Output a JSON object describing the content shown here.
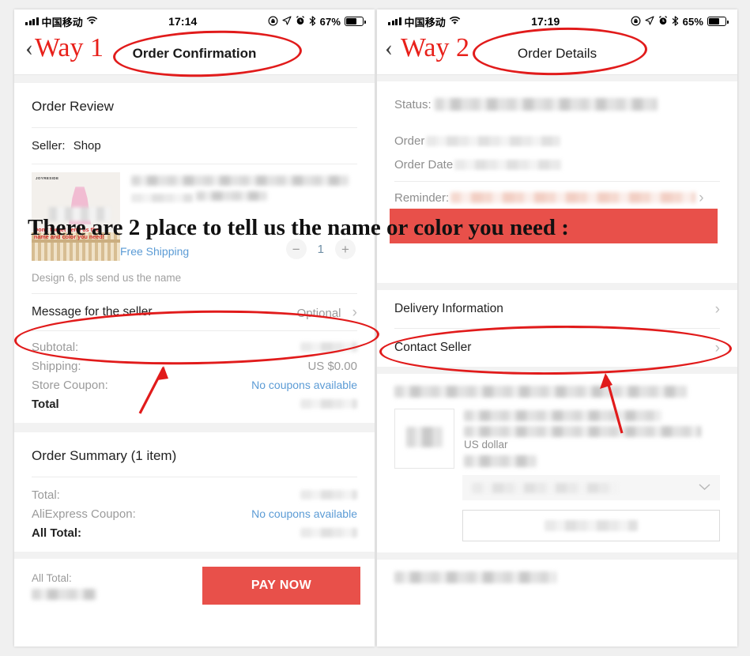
{
  "annotations": {
    "way1_label": "Way 1",
    "way2_label": "Way 2",
    "back_chevron": "‹",
    "overlay_line": "There are 2 place to tell us the name or color you need :",
    "accent_red": "#e11b1b",
    "band_red": "#e8504a"
  },
  "left_phone": {
    "statusbar": {
      "carrier": "中国移动",
      "wifi_icon": "wifi-icon",
      "time": "17:14",
      "rotation_lock_icon": "rotation-lock-icon",
      "location_icon": "location-arrow-icon",
      "alarm_icon": "alarm-clock-icon",
      "bluetooth_icon": "bluetooth-icon",
      "battery_percent": "67%",
      "battery_level": 67
    },
    "navbar": {
      "title": "Order Confirmation"
    },
    "order_review": {
      "heading": "Order Review",
      "seller_label": "Seller:",
      "seller_name": "Shop",
      "product_image": {
        "brand": "JOYRESIDE",
        "caption_line1": "Don't forget send us the",
        "caption_line2": "name and color you need!"
      },
      "shipping_tag": "Free Shipping",
      "quantity": "1",
      "minus_label": "−",
      "plus_label": "+",
      "variant_note": "Design 6, pls send us the name"
    },
    "message_row": {
      "label": "Message for the seller",
      "value": "Optional",
      "chevron": "›"
    },
    "price_rows": [
      {
        "label": "Subtotal:",
        "value": "",
        "value_blurred": true
      },
      {
        "label": "Shipping:",
        "value": "US $0.00",
        "value_blurred": false
      },
      {
        "label": "Store Coupon:",
        "value": "No coupons available",
        "value_blurred": false,
        "link": true
      },
      {
        "label": "Total",
        "value": "",
        "value_blurred": true,
        "bold": true
      }
    ],
    "order_summary": {
      "heading": "Order Summary (1 item)",
      "rows": [
        {
          "label": "Total:",
          "value": "",
          "value_blurred": true
        },
        {
          "label": "AliExpress Coupon:",
          "value": "No coupons available",
          "value_blurred": false,
          "link": true
        },
        {
          "label": "All Total:",
          "value": "",
          "value_blurred": true,
          "bold": true
        }
      ]
    },
    "paybar": {
      "total_label": "All Total:",
      "total_value": "",
      "pay_button": "PAY NOW"
    }
  },
  "right_phone": {
    "statusbar": {
      "carrier": "中国移动",
      "wifi_icon": "wifi-icon",
      "time": "17:19",
      "rotation_lock_icon": "rotation-lock-icon",
      "location_icon": "location-arrow-icon",
      "alarm_icon": "alarm-clock-icon",
      "bluetooth_icon": "bluetooth-icon",
      "battery_percent": "65%",
      "battery_level": 65
    },
    "navbar": {
      "title": "Order Details"
    },
    "details": [
      {
        "label": "Status:",
        "value": "",
        "value_blurred": true
      },
      {
        "label": "Order",
        "value": "",
        "value_blurred": true
      },
      {
        "label": "Order Date",
        "value": "",
        "value_blurred": true
      },
      {
        "label": "Reminder:",
        "value": "",
        "value_blurred": true,
        "pink": true
      }
    ],
    "links": [
      {
        "label": "Delivery Information",
        "chevron": "›"
      },
      {
        "label": "Contact Seller",
        "chevron": "›"
      }
    ],
    "order_item": {
      "title": "",
      "currency_note": "US dollar",
      "select_value": "",
      "select_chevron": "chevron-down-icon",
      "action_button": ""
    }
  }
}
